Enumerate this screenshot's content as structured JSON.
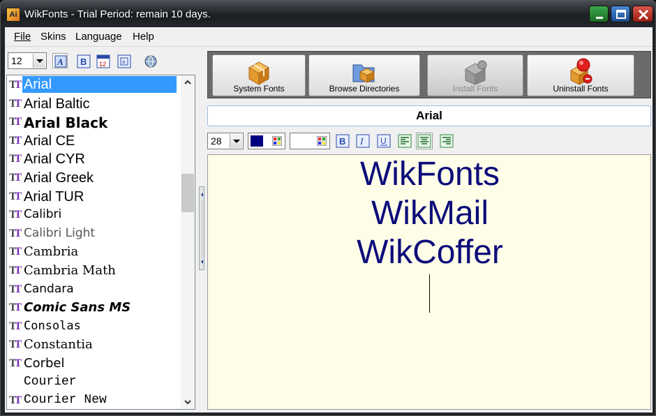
{
  "window": {
    "title": "WikFonts - Trial Period: remain 10 days.",
    "app_icon_text": "Ai"
  },
  "menu": [
    {
      "label": "File",
      "key": "F"
    },
    {
      "label": "Skins",
      "key": "S"
    },
    {
      "label": "Language",
      "key": "L"
    },
    {
      "label": "Help",
      "key": "H"
    }
  ],
  "left_toolbar": {
    "size_value": "12"
  },
  "font_list": {
    "selected": "Arial",
    "items": [
      {
        "name": "Arial",
        "font": "Liberation Sans",
        "weight": "normal",
        "size": 20,
        "tt_icon": true
      },
      {
        "name": "Arial Baltic",
        "font": "Liberation Sans",
        "weight": "normal",
        "size": 20,
        "tt_icon": true
      },
      {
        "name": "Arial Black",
        "font": "DejaVu Sans",
        "weight": "bold",
        "size": 20,
        "tt_icon": true
      },
      {
        "name": "Arial CE",
        "font": "Liberation Sans",
        "weight": "normal",
        "size": 20,
        "tt_icon": true
      },
      {
        "name": "Arial CYR",
        "font": "Liberation Sans",
        "weight": "normal",
        "size": 20,
        "tt_icon": true
      },
      {
        "name": "Arial Greek",
        "font": "Liberation Sans",
        "weight": "normal",
        "size": 20,
        "tt_icon": true
      },
      {
        "name": "Arial TUR",
        "font": "Liberation Sans",
        "weight": "normal",
        "size": 20,
        "tt_icon": true
      },
      {
        "name": "Calibri",
        "font": "DejaVu Sans",
        "weight": "normal",
        "size": 17,
        "tt_icon": true
      },
      {
        "name": "Calibri Light",
        "font": "DejaVu Sans",
        "weight": "normal",
        "size": 17,
        "color": "#555",
        "tt_icon": true
      },
      {
        "name": "Cambria",
        "font": "DejaVu Serif",
        "weight": "normal",
        "size": 18,
        "tt_icon": true
      },
      {
        "name": "Cambria Math",
        "font": "DejaVu Serif",
        "weight": "normal",
        "size": 18,
        "tt_icon": true
      },
      {
        "name": "Candara",
        "font": "DejaVu Sans",
        "weight": "normal",
        "size": 17,
        "tt_icon": true
      },
      {
        "name": "Comic Sans MS",
        "font": "DejaVu Sans",
        "weight": "bold",
        "size": 18,
        "style": "italic",
        "tt_icon": true
      },
      {
        "name": "Consolas",
        "font": "DejaVu Sans Mono",
        "weight": "normal",
        "size": 17,
        "tt_icon": true
      },
      {
        "name": "Constantia",
        "font": "DejaVu Serif",
        "weight": "normal",
        "size": 18,
        "tt_icon": true
      },
      {
        "name": "Corbel",
        "font": "DejaVu Sans",
        "weight": "normal",
        "size": 18,
        "tt_icon": true
      },
      {
        "name": "Courier",
        "font": "Liberation Mono",
        "weight": "normal",
        "size": 18,
        "tt_icon": false
      },
      {
        "name": "Courier New",
        "font": "Liberation Mono",
        "weight": "normal",
        "size": 18,
        "tt_icon": true
      }
    ]
  },
  "big_buttons": [
    {
      "label": "System Fonts",
      "icon": "box-icon",
      "enabled": true
    },
    {
      "label": "Browse Directories",
      "icon": "folder-box-icon",
      "enabled": true
    },
    {
      "label": "Install Fonts",
      "icon": "install-icon",
      "enabled": false
    },
    {
      "label": "Uninstall Fonts",
      "icon": "uninstall-icon",
      "enabled": true
    }
  ],
  "font_name_display": "Arial",
  "format_bar": {
    "size_value": "28",
    "text_color": "#000080",
    "background_color": "#ffffff"
  },
  "preview": {
    "lines": [
      "WikFonts",
      "WikMail",
      "WikCoffer"
    ],
    "text_color": "#0c0c7a",
    "background_color": "#fdfde8"
  }
}
